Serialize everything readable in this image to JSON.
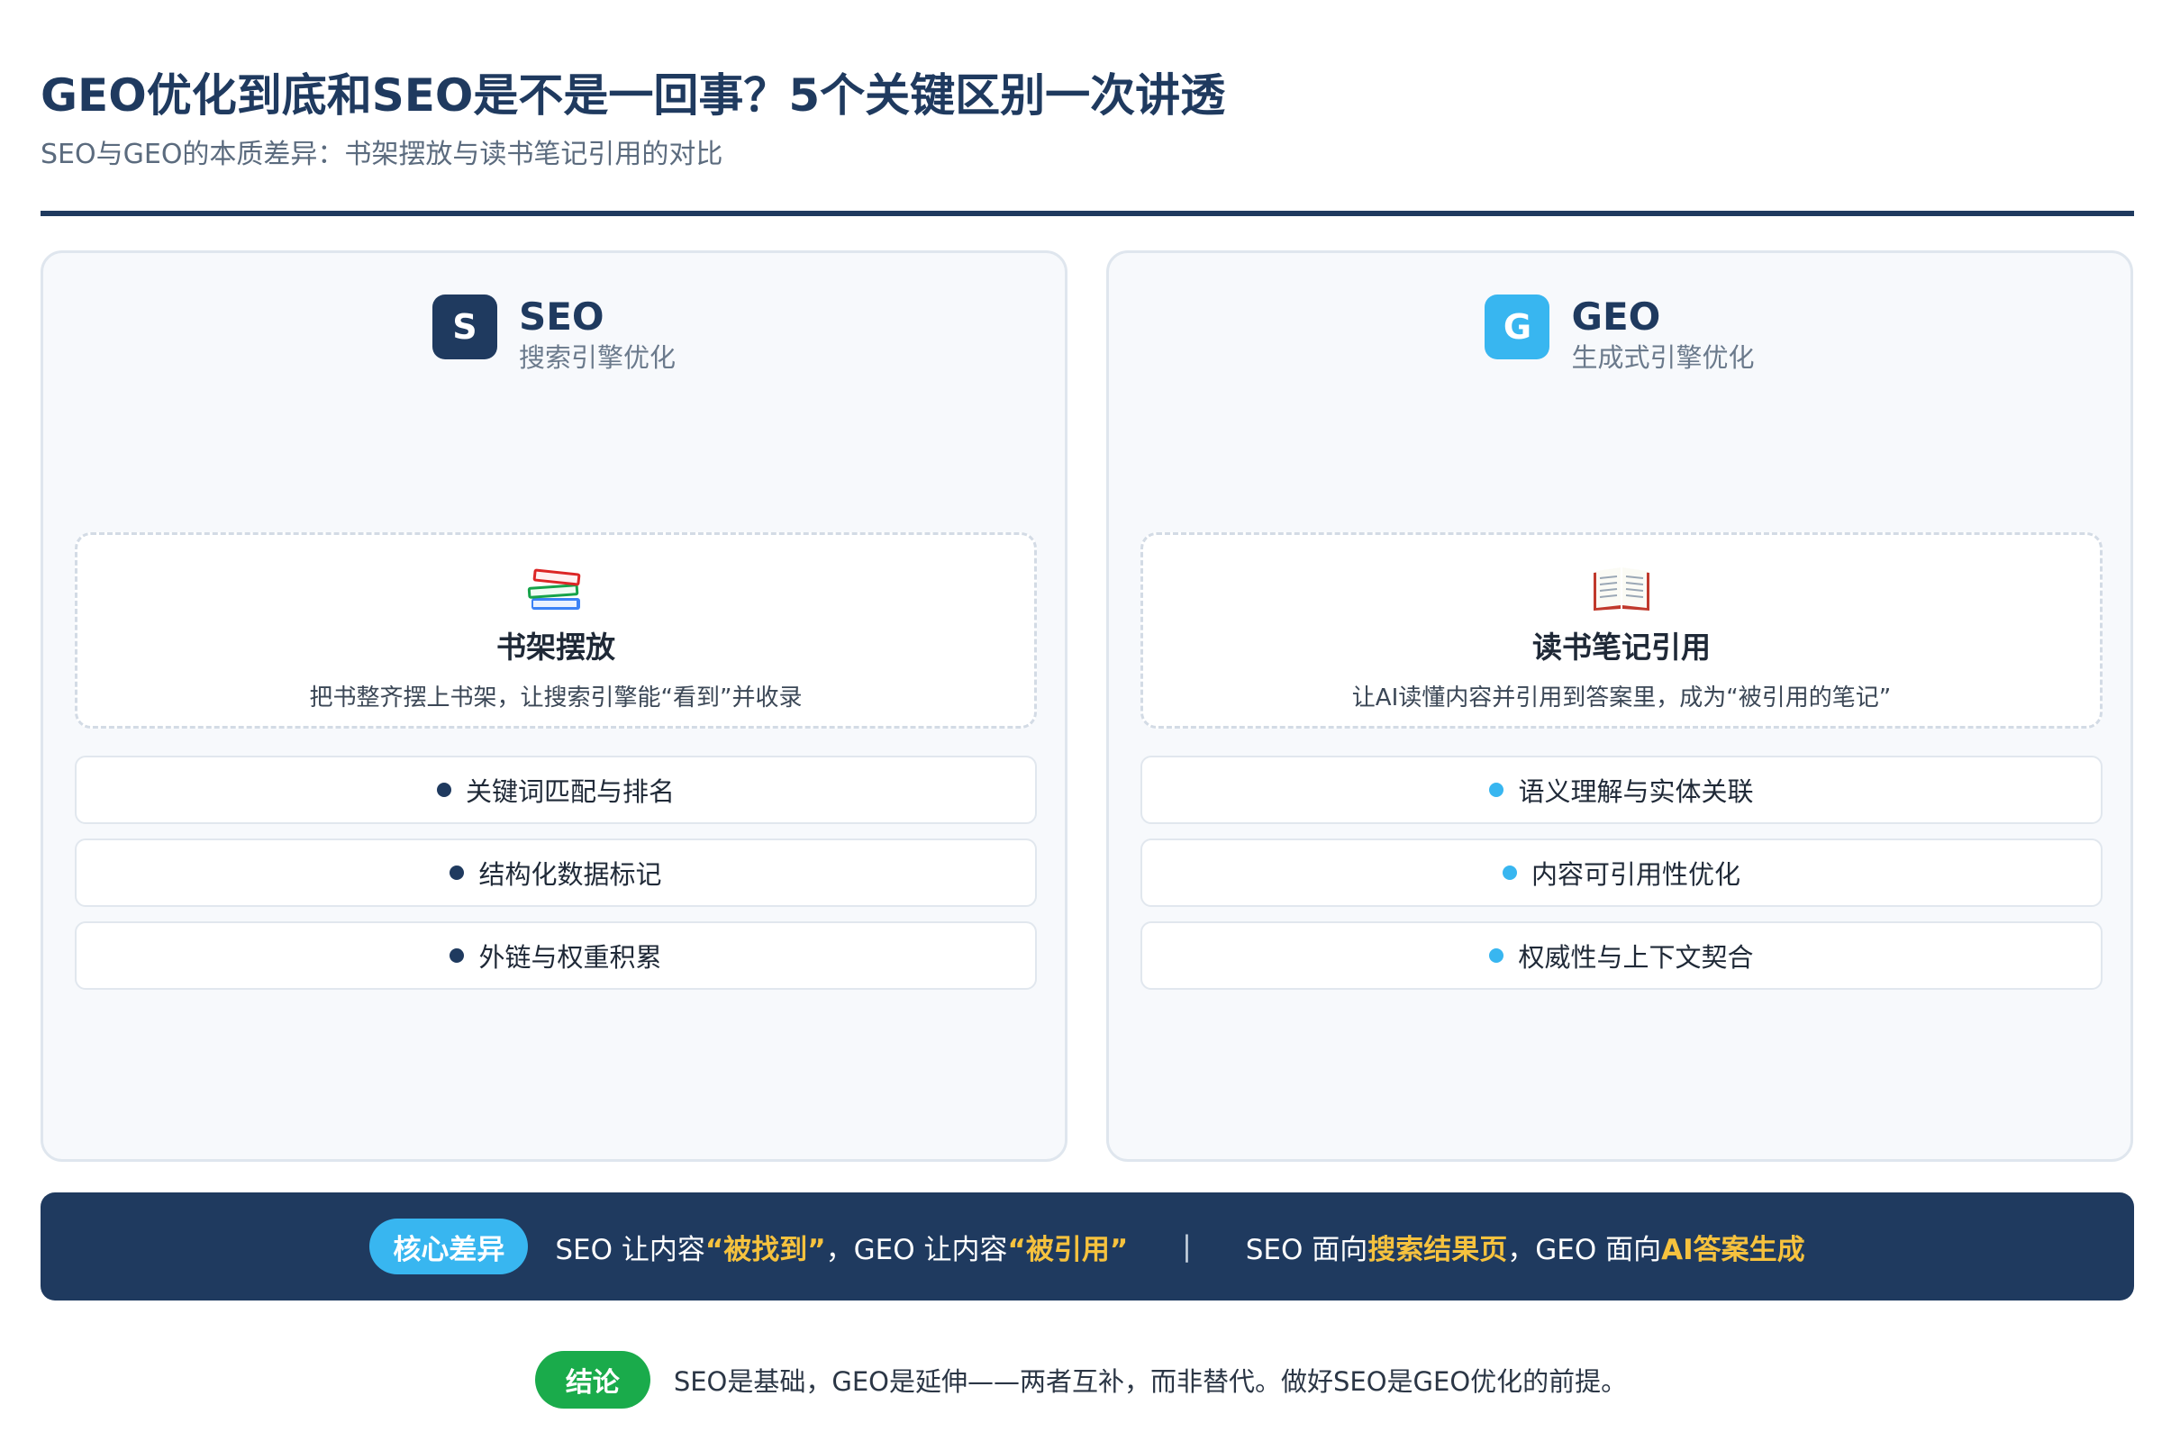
{
  "header": {
    "title": "GEO优化到底和SEO是不是一回事？5个关键区别一次讲透",
    "subtitle": "SEO与GEO的本质差异：书架摆放与读书笔记引用的对比"
  },
  "panels": [
    {
      "badge": "S",
      "name": "SEO",
      "full_name": "搜索引擎优化",
      "accent": "#1f3a5f",
      "concept": {
        "icon": "stacked-books-icon",
        "title": "书架摆放",
        "desc": "把书整齐摆上书架，让搜索引擎能“看到”并收录"
      },
      "features": [
        "关键词匹配与排名",
        "结构化数据标记",
        "外链与权重积累"
      ]
    },
    {
      "badge": "G",
      "name": "GEO",
      "full_name": "生成式引擎优化",
      "accent": "#38b6f0",
      "concept": {
        "icon": "open-book-icon",
        "title": "读书笔记引用",
        "desc": "让AI读懂内容并引用到答案里，成为“被引用的笔记”"
      },
      "features": [
        "语义理解与实体关联",
        "内容可引用性优化",
        "权威性与上下文契合"
      ]
    }
  ],
  "banner": {
    "pill": "核心差异",
    "part1_pre": "SEO 让内容",
    "part1_hl": "“被找到”",
    "part1_mid": "，GEO 让内容",
    "part1_hl2": "“被引用”",
    "separator": "|",
    "part2_pre": "SEO 面向",
    "part2_hl": "搜索结果页",
    "part2_mid": "，GEO 面向",
    "part2_hl2": "AI答案生成"
  },
  "conclusion": {
    "pill": "结论",
    "text": "SEO是基础，GEO是延伸——两者互补，而非替代。做好SEO是GEO优化的前提。"
  },
  "colors": {
    "navy": "#1f3a5f",
    "sky": "#38b6f0",
    "highlight": "#f6c23e",
    "green": "#1aab4b"
  }
}
